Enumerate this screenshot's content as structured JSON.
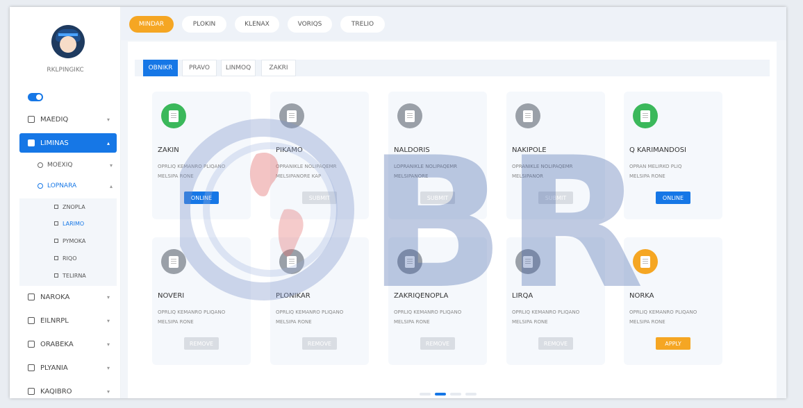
{
  "sidebar": {
    "username": "RKLPINGIKC",
    "menu": [
      {
        "label": "MAEDIQ",
        "active": false
      },
      {
        "label": "LIMINAS",
        "active": true
      },
      {
        "label": "NAROKA",
        "active": false
      },
      {
        "label": "EILNRPL",
        "active": false
      },
      {
        "label": "ORABEKA",
        "active": false
      },
      {
        "label": "PLYANIA",
        "active": false
      },
      {
        "label": "KAQIBRO",
        "active": false
      }
    ],
    "submenu": [
      {
        "label": "MOEXIQ",
        "active": false
      },
      {
        "label": "LOPNARA",
        "active": true
      }
    ],
    "subsub": [
      {
        "label": "ZNOPLA",
        "active": false
      },
      {
        "label": "LARIMO",
        "active": true
      },
      {
        "label": "PYMOKA",
        "active": false
      },
      {
        "label": "RIQO",
        "active": false
      },
      {
        "label": "TELIRNA",
        "active": false
      }
    ]
  },
  "topnav": {
    "pills": [
      {
        "label": "MINDAR",
        "active": true
      },
      {
        "label": "PLOKIN",
        "active": false
      },
      {
        "label": "KLENAX",
        "active": false
      },
      {
        "label": "VORIQS",
        "active": false
      },
      {
        "label": "TRELIO",
        "active": false
      }
    ]
  },
  "filters": [
    {
      "label": "OBNIKR",
      "active": true
    },
    {
      "label": "PRAVO",
      "active": false
    },
    {
      "label": "LINMOQ",
      "active": false
    },
    {
      "label": "ZAKRI",
      "active": false
    }
  ],
  "cards": [
    {
      "title": "ZAKIN",
      "lines": [
        "OPRLIQ KEMANRO PLIQANO",
        "MELSIPA RONE"
      ],
      "button": "ONLINE",
      "state": "active",
      "icon": "green"
    },
    {
      "title": "PIKAMO",
      "lines": [
        "OPRANIKLE NOLIPAQEMR",
        "MELSIPANORE KAP"
      ],
      "button": "SUBMIT",
      "state": "disabled",
      "icon": "gray"
    },
    {
      "title": "NALDORIS",
      "lines": [
        "LOPRANIKLE NOLIPAQEMR",
        "MELSIPANORE"
      ],
      "button": "SUBMIT",
      "state": "disabled",
      "icon": "gray"
    },
    {
      "title": "NAKIPOLE",
      "lines": [
        "OPRANIKLE NOLIPAQEMR",
        "MELSIPANOR"
      ],
      "button": "SUBMIT",
      "state": "disabled",
      "icon": "gray"
    },
    {
      "title": "Q KARIMANDOSI",
      "lines": [
        "OPRAN MELIRKO PLIQ",
        "MELSIPA RONE"
      ],
      "button": "ONLINE",
      "state": "active",
      "icon": "green"
    },
    {
      "title": "NOVERI",
      "lines": [
        "OPRLIQ KEMANRO PLIQANO",
        "MELSIPA RONE"
      ],
      "button": "REMOVE",
      "state": "disabled",
      "icon": "gray"
    },
    {
      "title": "PLONIKAR",
      "lines": [
        "OPRLIQ KEMANRO PLIQANO",
        "MELSIPA RONE"
      ],
      "button": "REMOVE",
      "state": "disabled",
      "icon": "gray"
    },
    {
      "title": "ZAKRIQENOPLA",
      "lines": [
        "OPRLIQ KEMANRO PLIQANO",
        "MELSIPA RONE"
      ],
      "button": "REMOVE",
      "state": "disabled",
      "icon": "gray"
    },
    {
      "title": "LIRQA",
      "lines": [
        "OPRLIQ KEMANRO PLIQANO",
        "MELSIPA RONE"
      ],
      "button": "REMOVE",
      "state": "disabled",
      "icon": "gray"
    },
    {
      "title": "NORKA",
      "lines": [
        "OPRLIQ KEMANRO PLIQANO",
        "MELSIPA RONE"
      ],
      "button": "APPLY",
      "state": "pending",
      "icon": "orange"
    }
  ],
  "watermark": {
    "text": "BR"
  },
  "colors": {
    "primary": "#1677e6",
    "accent": "#f5a623",
    "success": "#3bb85b",
    "muted": "#9aa0a8"
  }
}
